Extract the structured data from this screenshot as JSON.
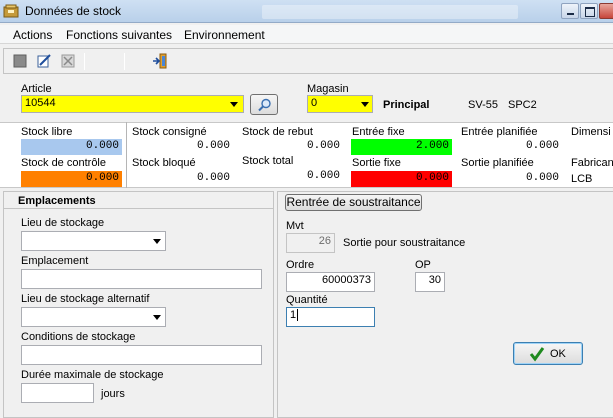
{
  "window": {
    "title": "Données de stock"
  },
  "menu": {
    "items": [
      "Actions",
      "Fonctions suivantes",
      "Environnement"
    ]
  },
  "header": {
    "article_label": "Article",
    "article_value": "10544",
    "magasin_label": "Magasin",
    "magasin_value": "0",
    "magasin_desc": "Principal",
    "model": "SV-55",
    "spec": "SPC2"
  },
  "stock": {
    "libre": {
      "label": "Stock libre",
      "value": "0.000"
    },
    "controle": {
      "label": "Stock de contrôle",
      "value": "0.000"
    },
    "consigne": {
      "label": "Stock consigné",
      "value": "0.000"
    },
    "bloque": {
      "label": "Stock bloqué",
      "value": "0.000"
    },
    "rebut": {
      "label": "Stock de rebut",
      "value": "0.000"
    },
    "total": {
      "label": "Stock total",
      "value": "0.000"
    },
    "entree_fixe": {
      "label": "Entrée fixe",
      "value": "2.000"
    },
    "sortie_fixe": {
      "label": "Sortie fixe",
      "value": "0.000"
    },
    "entree_planifiee": {
      "label": "Entrée planifiée",
      "value": "0.000"
    },
    "sortie_planifiee": {
      "label": "Sortie planifiée",
      "value": "0.000"
    },
    "dimension_label": "Dimensi",
    "fabricant_label": "Fabrican",
    "fabricant_value": "LCB"
  },
  "emplacements": {
    "title": "Emplacements",
    "lieu_label": "Lieu de stockage",
    "lieu_value": "",
    "emplacement_label": "Emplacement",
    "emplacement_value": "",
    "lieu_alt_label": "Lieu de stockage alternatif",
    "lieu_alt_value": "",
    "conditions_label": "Conditions de stockage",
    "conditions_value": "",
    "duree_label": "Durée maximale de stockage",
    "duree_value": "",
    "duree_unit": "jours"
  },
  "rentree": {
    "tab_label": "Rentrée de soustraitance",
    "mvt_label": "Mvt",
    "mvt_value": "26",
    "mvt_desc": "Sortie pour soustraitance",
    "ordre_label": "Ordre",
    "ordre_value": "60000373",
    "op_label": "OP",
    "op_value": "30",
    "quantite_label": "Quantité",
    "quantite_value": "1",
    "ok_label": "OK"
  },
  "colors": {
    "article_bg": "#ffff00",
    "stock_libre": "#a8c8ee",
    "stock_controle": "#ff8000",
    "entree_fixe": "#00ff00",
    "sortie_fixe": "#ff0000"
  },
  "icons": [
    "app-icon",
    "save-icon",
    "edit-icon",
    "delete-icon",
    "exit-icon",
    "search-icon",
    "checkmark-icon"
  ]
}
